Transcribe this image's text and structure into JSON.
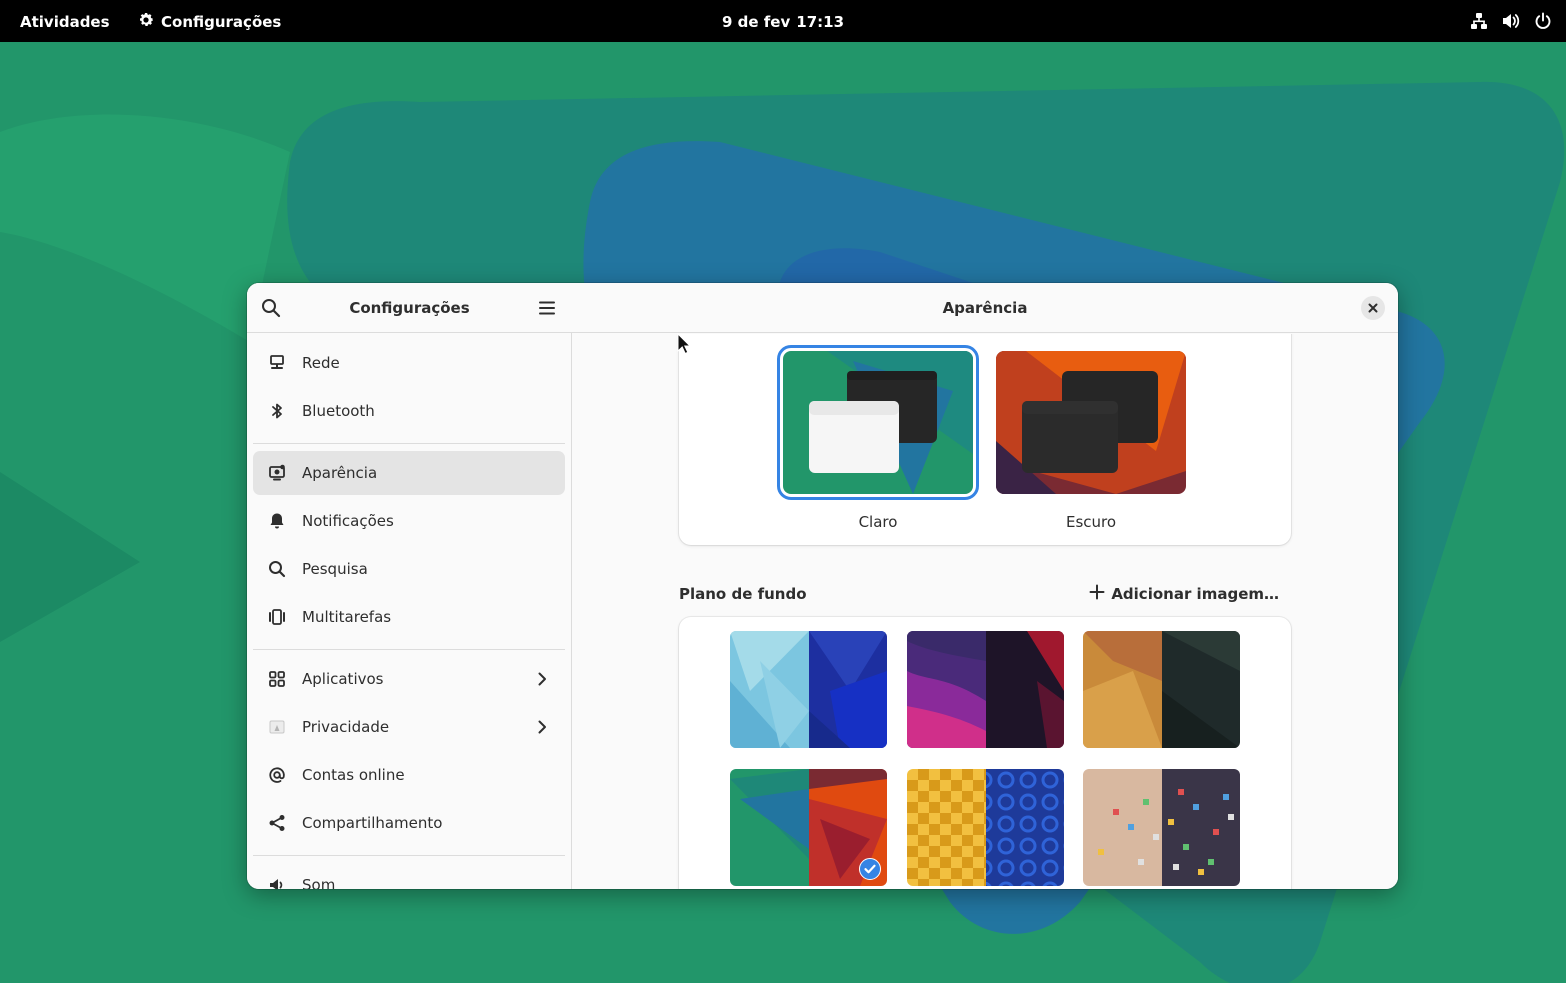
{
  "topbar": {
    "activities": "Atividades",
    "app_name": "Configurações",
    "date": "9 de fev",
    "time": "17:13",
    "status_icons": [
      "network-icon",
      "volume-icon",
      "power-icon"
    ]
  },
  "window": {
    "sidebar": {
      "title": "Configurações",
      "items": [
        {
          "label": "Rede",
          "icon": "network-wired-icon"
        },
        {
          "label": "Bluetooth",
          "icon": "bluetooth-icon"
        },
        {
          "label": "Aparência",
          "icon": "appearance-icon",
          "selected": true
        },
        {
          "label": "Notificações",
          "icon": "bell-icon"
        },
        {
          "label": "Pesquisa",
          "icon": "search-icon"
        },
        {
          "label": "Multitarefas",
          "icon": "multitasking-icon"
        },
        {
          "label": "Aplicativos",
          "icon": "apps-grid-icon",
          "has_submenu": true
        },
        {
          "label": "Privacidade",
          "icon": "privacy-icon",
          "has_submenu": true
        },
        {
          "label": "Contas online",
          "icon": "at-sign-icon"
        },
        {
          "label": "Compartilhamento",
          "icon": "share-icon"
        },
        {
          "label": "Som",
          "icon": "sound-icon"
        }
      ]
    },
    "content": {
      "title": "Aparência",
      "style_options": [
        {
          "label": "Claro",
          "selected": true
        },
        {
          "label": "Escuro",
          "selected": false
        }
      ],
      "background_section_title": "Plano de fundo",
      "add_image_label": "Adicionar imagem…",
      "selected_wallpaper_index": 3
    }
  },
  "colors": {
    "accent": "#3584e4",
    "selected_row": "#e4e4e4",
    "sidebar_bg": "#fafafa",
    "topbar": "#000000"
  }
}
